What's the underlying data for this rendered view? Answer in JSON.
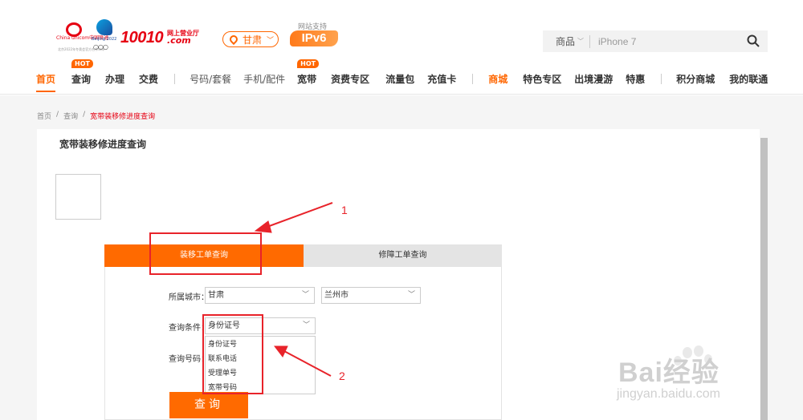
{
  "header": {
    "logo_unicom_text": "China unicom中国联通",
    "logo_bj_text": "Beijing 2022",
    "logo_sub_text": "北京2022年冬奥会官方合作伙伴",
    "logo_number": "10010",
    "logo_com_top": "网上营业厅",
    "logo_com_bottom": ".com",
    "city": "甘肃",
    "ipv6_support": "网站支持",
    "ipv6_badge": "IPv6",
    "search": {
      "category": "商品",
      "placeholder": "iPhone 7"
    }
  },
  "nav": {
    "items": [
      {
        "label": "首页"
      },
      {
        "label": "查询",
        "badge": "HOT"
      },
      {
        "label": "办理"
      },
      {
        "label": "交费"
      },
      {
        "label": "号码/套餐"
      },
      {
        "label": "手机/配件"
      },
      {
        "label": "宽带",
        "badge": "HOT"
      },
      {
        "label": "资费专区"
      },
      {
        "label": "流量包"
      },
      {
        "label": "充值卡"
      },
      {
        "label": "商城"
      },
      {
        "label": "特色专区"
      },
      {
        "label": "出境漫游"
      },
      {
        "label": "特惠"
      },
      {
        "label": "积分商城"
      },
      {
        "label": "我的联通"
      }
    ]
  },
  "breadcrumb": {
    "home": "首页",
    "sep": "/",
    "query": "查询",
    "current": "宽带装移修进度查询"
  },
  "panel": {
    "title": "宽带装移修进度查询",
    "tabs": [
      {
        "label": "装移工单查询"
      },
      {
        "label": "修障工单查询"
      }
    ],
    "city_label": "所属城市：",
    "province": "甘肃",
    "city": "兰州市",
    "condition_label": "查询条件：",
    "condition_selected": "身份证号",
    "number_label": "查询号码：",
    "condition_options": [
      "身份证号",
      "联系电话",
      "受理单号",
      "宽带号码"
    ],
    "query_button": "查询"
  },
  "annotations": {
    "marker1": "1",
    "marker2": "2",
    "color": "#e8232a"
  },
  "watermark": {
    "text": "Bai经验",
    "sub": "jingyan.baidu.com"
  },
  "colors": {
    "accent": "#ff6a00",
    "brand_red": "#e60012"
  }
}
